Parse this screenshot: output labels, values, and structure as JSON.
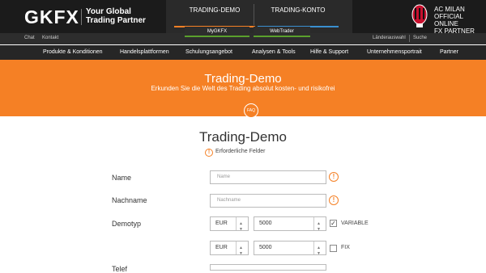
{
  "header": {
    "logo": "GKFX",
    "tagline_line1": "Your Global",
    "tagline_line2": "Trading Partner",
    "tabs": [
      "TRADING-DEMO",
      "TRADING-KONTO"
    ],
    "partner_line1": "AC MILAN",
    "partner_line2": "OFFICIAL ONLINE",
    "partner_line3": "FX PARTNER"
  },
  "subbar": {
    "chat": "Chat",
    "kontakt": "Kontakt",
    "mygkfx": "MyGKFX",
    "webtrader": "WebTrader",
    "country": "Länderauswahl",
    "search": "Suche"
  },
  "nav": [
    "Produkte & Konditionen",
    "Handelsplattformen",
    "Schulungsangebot",
    "Analysen & Tools",
    "Hilfe & Support",
    "Unternehmensportrait",
    "Partner"
  ],
  "banner": {
    "title": "Trading-Demo",
    "subtitle": "Erkunden Sie die Welt des Trading absolut kosten- und risikofrei",
    "faq": "FAQ"
  },
  "form": {
    "title": "Trading-Demo",
    "required_note": "Erforderliche Felder",
    "name_label": "Name",
    "name_placeholder": "Name",
    "nachname_label": "Nachname",
    "nachname_placeholder": "Nachname",
    "demotyp_label": "Demotyp",
    "row1_currency": "EUR",
    "row1_amount": "5000",
    "row1_option": "VARIABLE",
    "row2_currency": "EUR",
    "row2_amount": "5000",
    "row2_option": "FIX",
    "telefon_label": "Telef"
  },
  "colors": {
    "accent": "#f58025",
    "dark": "#1b1b1b"
  }
}
